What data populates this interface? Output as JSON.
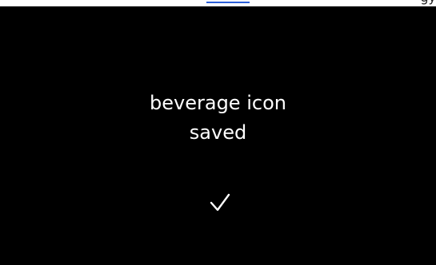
{
  "top_fragment": {
    "text": "gy"
  },
  "confirmation": {
    "line1": "beverage icon",
    "line2": "saved",
    "icon": "checkmark-icon"
  },
  "colors": {
    "screen_background": "#000000",
    "text": "#ffffff",
    "link": "#2b5fd9"
  }
}
